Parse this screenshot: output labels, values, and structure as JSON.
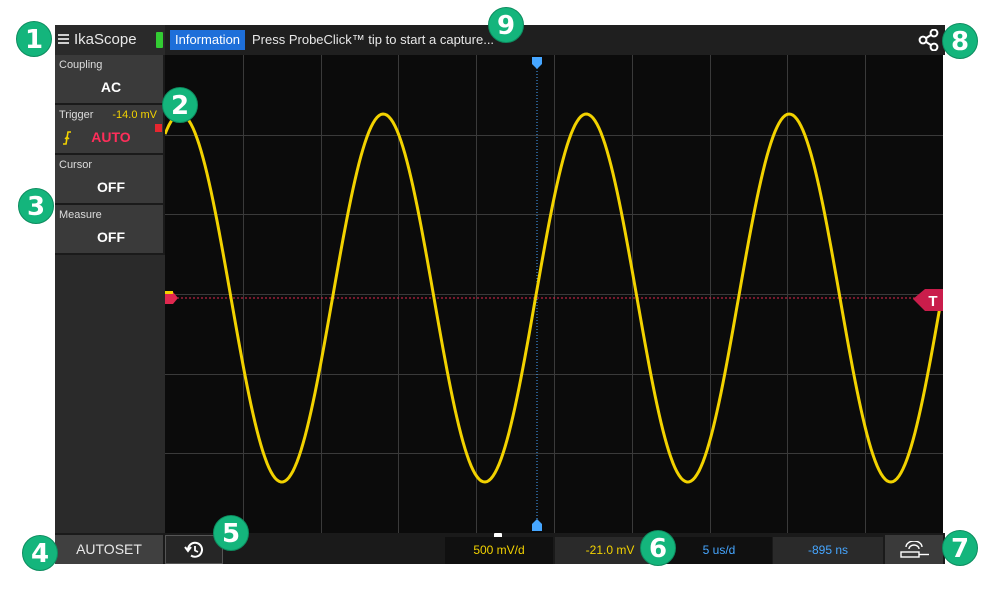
{
  "header": {
    "app_title": "IkaScope",
    "info_label": "Information",
    "info_message": "Press ProbeClick™ tip to start a capture..."
  },
  "left_panel": {
    "coupling": {
      "label": "Coupling",
      "value": "AC"
    },
    "trigger": {
      "label": "Trigger",
      "level": "-14.0 mV",
      "mode": "AUTO"
    },
    "cursor": {
      "label": "Cursor",
      "value": "OFF"
    },
    "measure": {
      "label": "Measure",
      "value": "OFF"
    }
  },
  "bottom_bar": {
    "autoset_label": "AUTOSET",
    "volts_per_div": "500 mV/d",
    "trigger_offset": "-21.0 mV",
    "time_per_div": "5 us/d",
    "time_offset": "-895 ns"
  },
  "screen": {
    "trigger_marker_label": "T"
  },
  "callouts": [
    "1",
    "2",
    "3",
    "4",
    "5",
    "6",
    "7",
    "8",
    "9"
  ],
  "colors": {
    "waveform": "#f2d200",
    "trigger": "#e0284f",
    "time_marker": "#46a6ff",
    "info_badge": "#1e6fd9",
    "callout": "#14b57c"
  }
}
